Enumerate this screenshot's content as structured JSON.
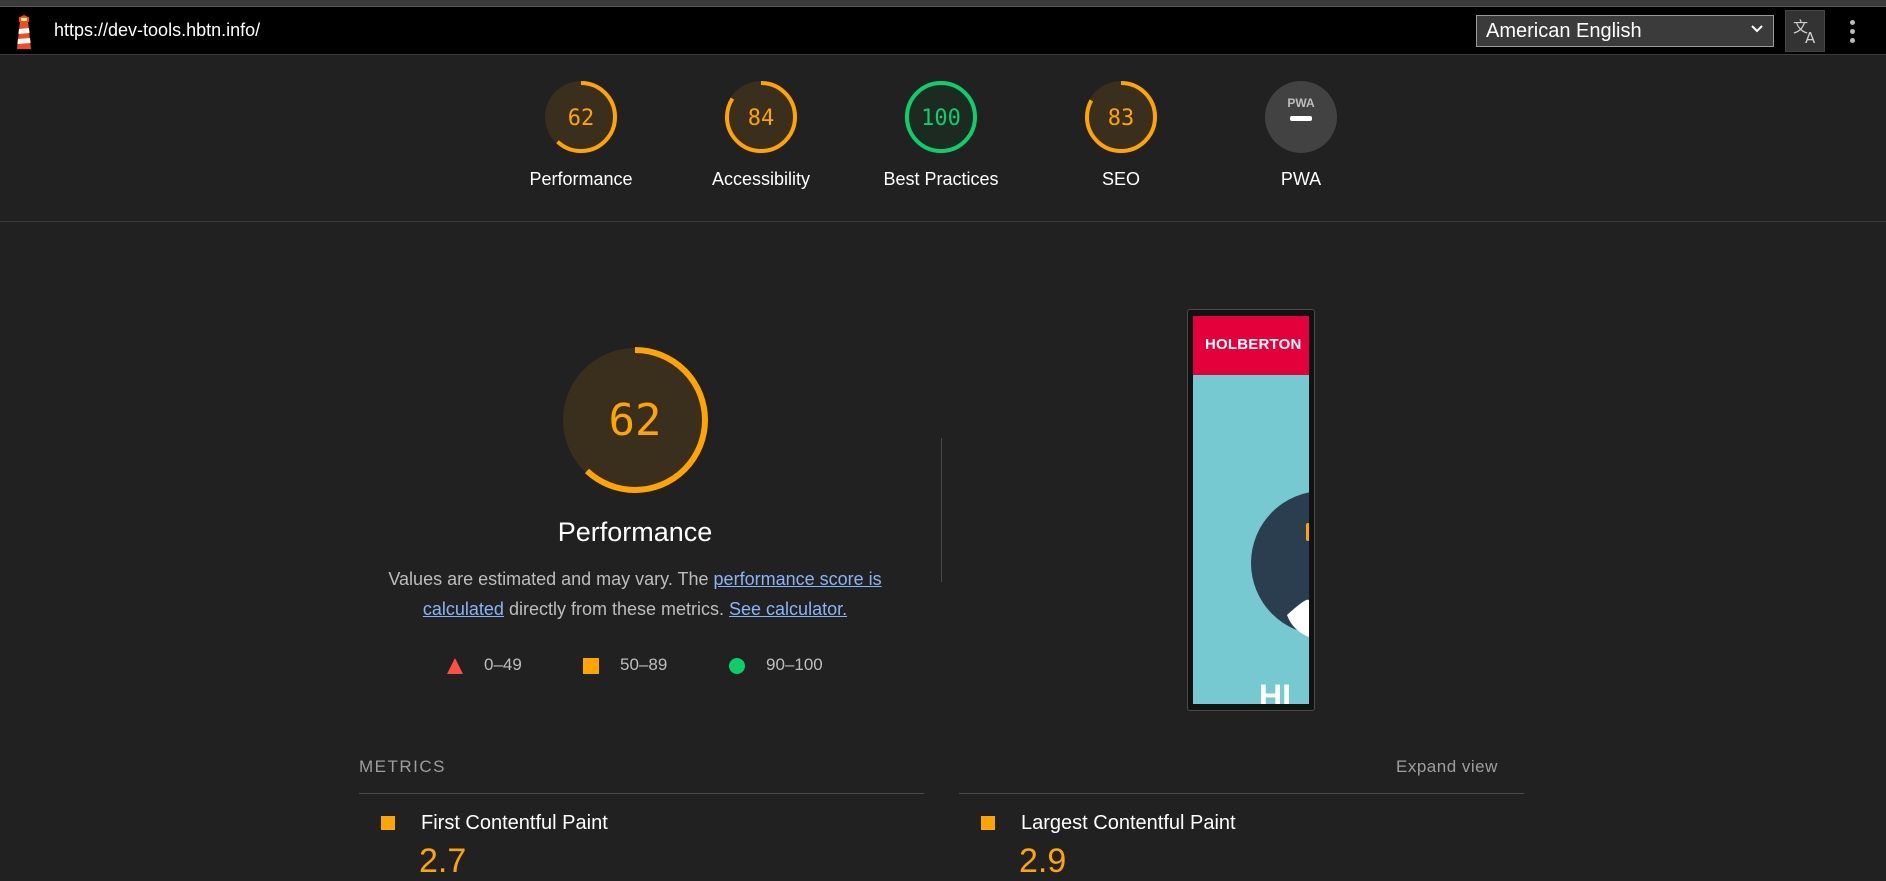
{
  "topbar": {
    "url": "https://dev-tools.hbtn.info/",
    "language": "American English",
    "translate_icon": "translate-icon",
    "menu_icon": "kebab-menu-icon"
  },
  "gauges": [
    {
      "label": "Performance",
      "score": "62",
      "value": 62,
      "color": "#ffa400",
      "bg": "#3a2e1c"
    },
    {
      "label": "Accessibility",
      "score": "84",
      "value": 84,
      "color": "#ffa400",
      "bg": "#3a2e1c"
    },
    {
      "label": "Best Practices",
      "score": "100",
      "value": 100,
      "color": "#0cce6b",
      "bg": "#1d2a22"
    },
    {
      "label": "SEO",
      "score": "83",
      "value": 83,
      "color": "#ffa400",
      "bg": "#3a2e1c"
    },
    {
      "label": "PWA",
      "badge": "PWA",
      "color": "#ffffff",
      "bg": "#424242"
    }
  ],
  "performance": {
    "score": "62",
    "value": 62,
    "title": "Performance",
    "desc_prefix": "Values are estimated and may vary. The ",
    "desc_link1": "performance score is calculated",
    "desc_mid": " directly from these metrics. ",
    "desc_link2": "See calculator."
  },
  "legend": [
    {
      "range": "0–49",
      "shape": "triangle",
      "color": "#ff4e42"
    },
    {
      "range": "50–89",
      "shape": "square",
      "color": "#ffa400"
    },
    {
      "range": "90–100",
      "shape": "circle",
      "color": "#0cce6b"
    }
  ],
  "screenshot": {
    "brand": "HOLBERTON",
    "partial_text": "HI"
  },
  "metrics": {
    "heading": "METRICS",
    "expand_label": "Expand view",
    "items": [
      {
        "name": "First Contentful Paint",
        "value": "2.7",
        "status_color": "#ffa400"
      },
      {
        "name": "Largest Contentful Paint",
        "value": "2.9",
        "status_color": "#ffa400"
      }
    ]
  },
  "colors": {
    "average": "#ffa400",
    "pass": "#0cce6b",
    "fail": "#ff4e42",
    "link": "#8ab4f8",
    "background": "#212121"
  }
}
